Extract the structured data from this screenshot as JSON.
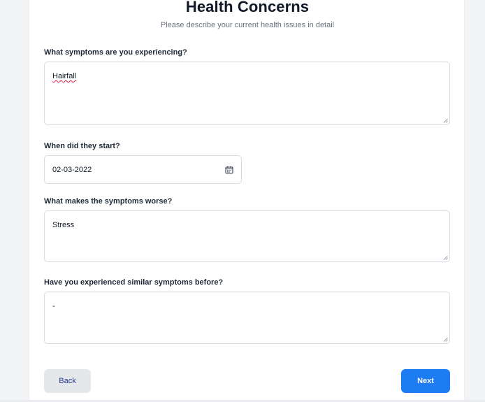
{
  "header": {
    "title": "Health Concerns",
    "subtitle": "Please describe your current health issues in detail"
  },
  "fields": {
    "symptoms": {
      "label": "What symptoms are you experiencing?",
      "value": "Hairfall"
    },
    "start_date": {
      "label": "When did they start?",
      "value": "02-03-2022"
    },
    "worse": {
      "label": "What makes the symptoms worse?",
      "value": "Stress"
    },
    "previous": {
      "label": "Have you experienced similar symptoms before?",
      "value": "-"
    }
  },
  "buttons": {
    "back_label": "Back",
    "next_label": "Next"
  },
  "colors": {
    "primary": "#1d7cf2",
    "secondary_bg": "#e5e7eb",
    "secondary_text": "#1e3a8a",
    "page_bg": "#f3f4f6"
  },
  "icons": {
    "date_picker": "calendar-icon",
    "resize_handle": "resize-handle-icon"
  }
}
